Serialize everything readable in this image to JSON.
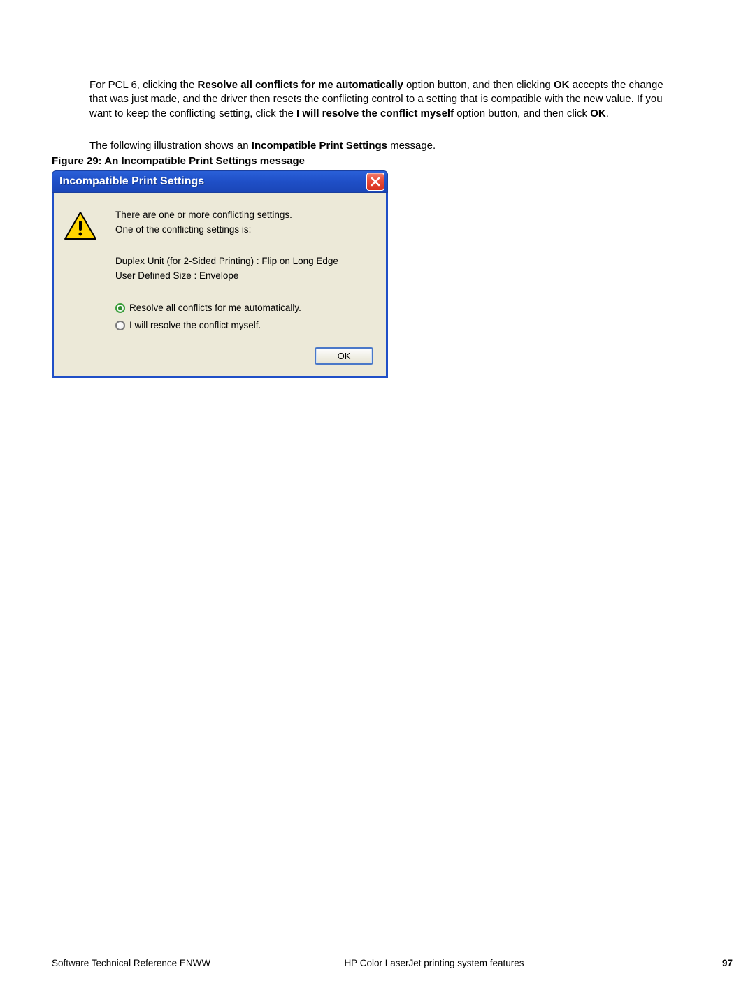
{
  "paragraph1": {
    "pre1": "For PCL 6, clicking the ",
    "b1": "Resolve all conflicts for me automatically",
    "mid1": " option button, and then clicking ",
    "b2": "OK",
    "mid2": " accepts the change that was just made, and the driver then resets the conflicting control to a setting that is compatible with the new value. If you want to keep the conflicting setting, click the ",
    "b3": "I will resolve the conflict myself",
    "mid3": " option button, and then click ",
    "b4": "OK",
    "post": "."
  },
  "paragraph2": {
    "pre": "The following illustration shows an ",
    "b": "Incompatible Print Settings",
    "post": " message."
  },
  "figure_caption": "Figure 29: An Incompatible Print Settings message",
  "dialog": {
    "title": "Incompatible Print Settings",
    "msg1": "There are one or more conflicting settings.",
    "msg2": "One of the conflicting settings is:",
    "detail1": "Duplex Unit (for 2-Sided Printing) : Flip on Long Edge",
    "detail2": "User Defined Size : Envelope",
    "radio1": "Resolve all conflicts for me automatically.",
    "radio2": "I will resolve the conflict myself.",
    "ok": "OK"
  },
  "footer": {
    "left": "Software Technical Reference ENWW",
    "center": "HP Color LaserJet printing system features",
    "right": "97"
  }
}
